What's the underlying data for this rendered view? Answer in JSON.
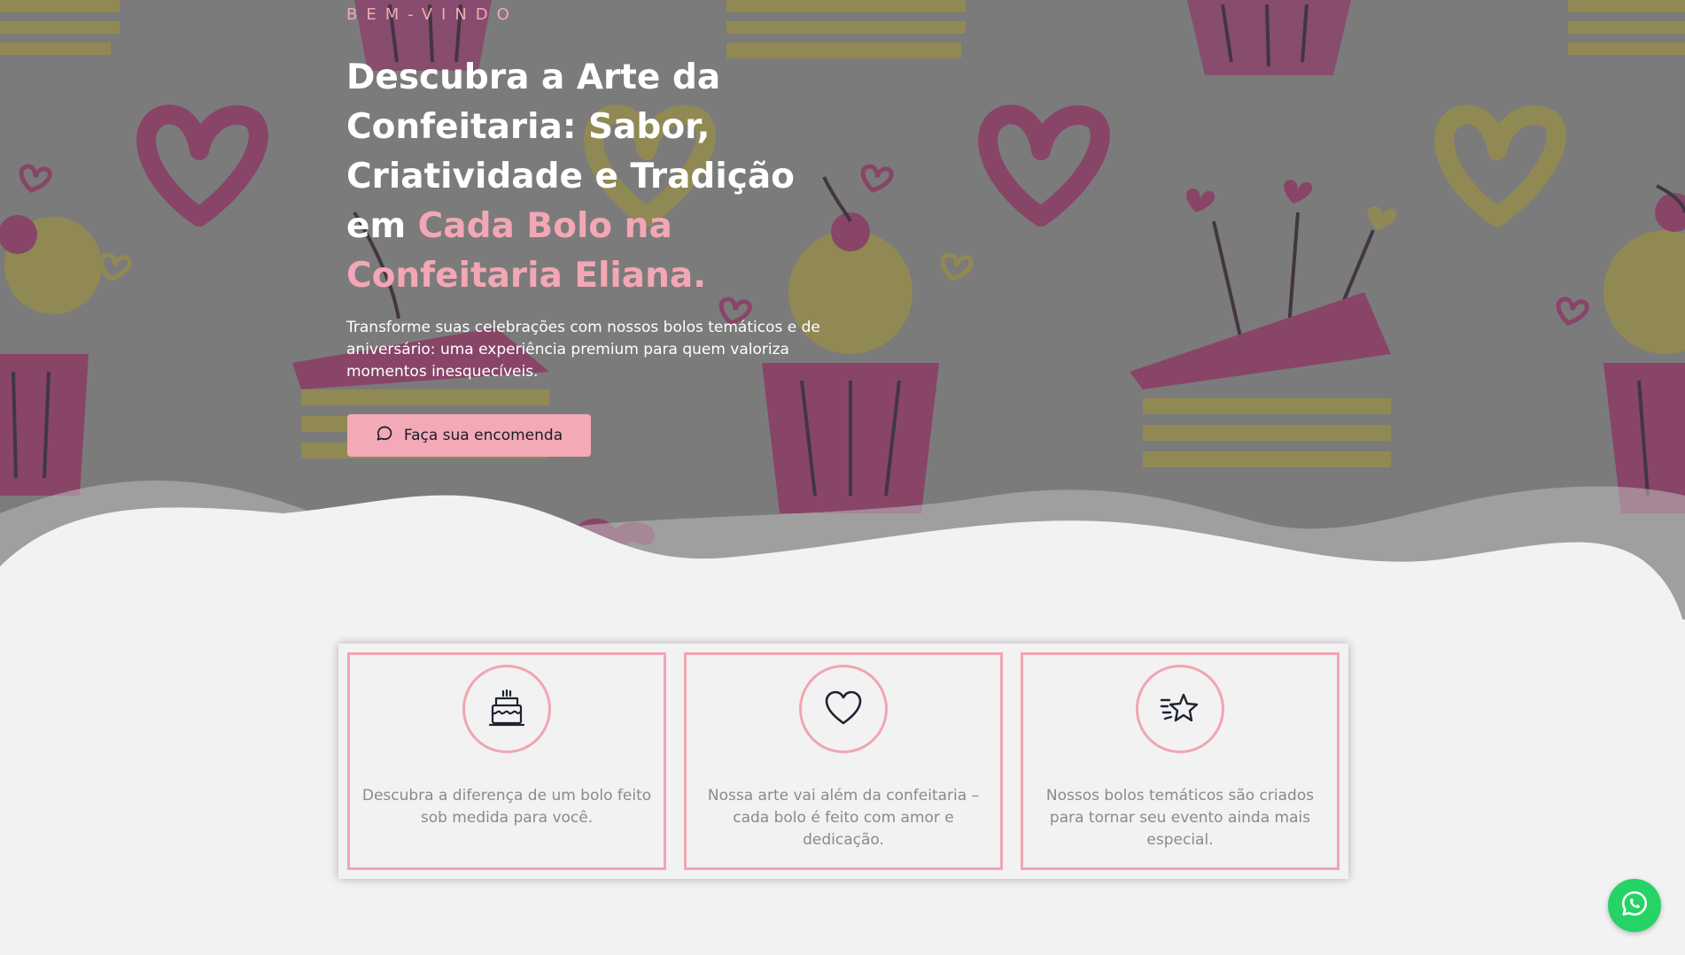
{
  "hero": {
    "eyebrow": "BEM-VINDO",
    "headline_white": "Descubra a Arte da Confeitaria: Sabor, Criatividade e Tradição em ",
    "headline_accent": "Cada Bolo na Confeitaria Eliana.",
    "subtitle": "Transforme suas celebrações com nossos bolos temáticos e de aniversário: uma experiência premium para quem valoriza momentos inesquecíveis.",
    "cta_label": "Faça sua encomenda",
    "cta_icon": "chat-bubble-icon"
  },
  "features": [
    {
      "icon": "cake-icon",
      "text": "Descubra a diferença de um bolo feito sob medida para você."
    },
    {
      "icon": "heart-icon",
      "text": "Nossa arte vai além da confeitaria – cada bolo é feito com amor e dedicação."
    },
    {
      "icon": "star-icon",
      "text": "Nossos bolos temáticos são criados para tornar seu evento ainda mais especial."
    }
  ],
  "whatsapp": {
    "icon": "whatsapp-icon"
  },
  "colors": {
    "accent_pink": "#f3a7b4",
    "card_border": "#f1a5b2",
    "whatsapp_green": "#25d366",
    "hero_overlay": "#7c7c7c",
    "text_gray": "#8a8a8a"
  }
}
